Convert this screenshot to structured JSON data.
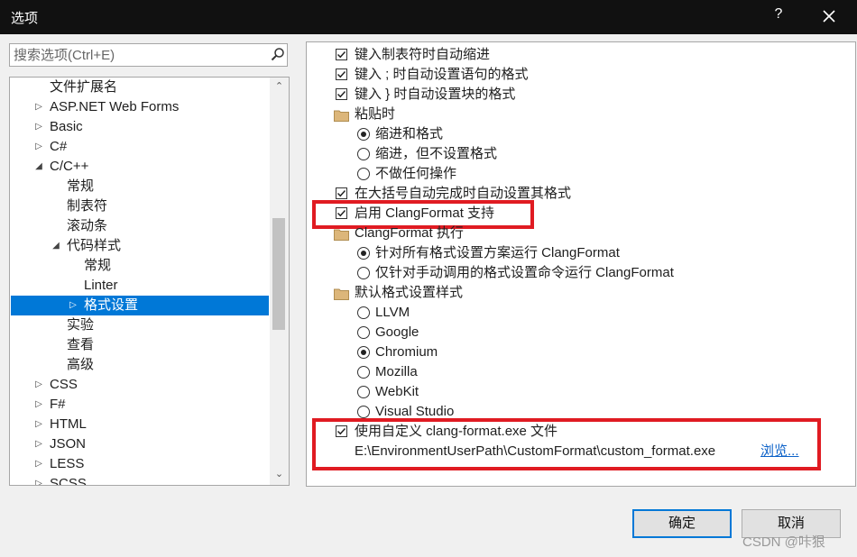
{
  "window": {
    "title": "选项",
    "help_label": "?"
  },
  "search": {
    "placeholder": "搜索选项(Ctrl+E)"
  },
  "tree": {
    "items": [
      {
        "label": "文件扩展名"
      },
      {
        "label": "ASP.NET Web Forms"
      },
      {
        "label": "Basic"
      },
      {
        "label": "C#"
      },
      {
        "label": "C/C++"
      },
      {
        "label": "常规"
      },
      {
        "label": "制表符"
      },
      {
        "label": "滚动条"
      },
      {
        "label": "代码样式"
      },
      {
        "label": "常规"
      },
      {
        "label": "Linter"
      },
      {
        "label": "格式设置"
      },
      {
        "label": "实验"
      },
      {
        "label": "查看"
      },
      {
        "label": "高级"
      },
      {
        "label": "CSS"
      },
      {
        "label": "F#"
      },
      {
        "label": "HTML"
      },
      {
        "label": "JSON"
      },
      {
        "label": "LESS"
      },
      {
        "label": "SCSS"
      }
    ]
  },
  "options": {
    "auto_indent_tab": "键入制表符时自动缩进",
    "format_statement_semicolon": "键入 ; 时自动设置语句的格式",
    "format_block_brace": "键入 } 时自动设置块的格式",
    "paste_group": "粘贴时",
    "paste_indent_format": "缩进和格式",
    "paste_indent_only": "缩进，但不设置格式",
    "paste_nothing": "不做任何操作",
    "brace_completion_format": "在大括号自动完成时自动设置其格式",
    "enable_clangformat": "启用 ClangFormat 支持",
    "clangformat_exec_group": "ClangFormat 执行",
    "run_all_scenarios": "针对所有格式设置方案运行 ClangFormat",
    "run_manual_only": "仅针对手动调用的格式设置命令运行 ClangFormat",
    "default_style_group": "默认格式设置样式",
    "styles": [
      "LLVM",
      "Google",
      "Chromium",
      "Mozilla",
      "WebKit",
      "Visual Studio"
    ],
    "custom_exe": "使用自定义 clang-format.exe 文件",
    "custom_path": "E:\\EnvironmentUserPath\\CustomFormat\\custom_format.exe",
    "browse_label": "浏览..."
  },
  "buttons": {
    "ok_label": "确定",
    "cancel_label": "取消"
  },
  "watermark": "CSDN @咔狠",
  "colors": {
    "accent": "#0078d7",
    "highlight_box": "#e01b22",
    "link": "#0b61c8"
  }
}
